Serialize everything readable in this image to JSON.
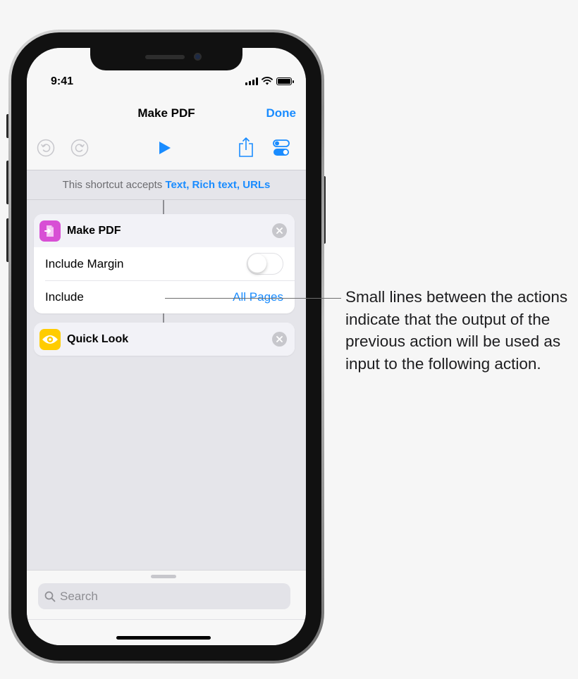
{
  "status_bar": {
    "time": "9:41"
  },
  "nav": {
    "title": "Make PDF",
    "done_label": "Done"
  },
  "toolbar": {
    "undo_icon": "undo-icon",
    "redo_icon": "redo-icon",
    "play_icon": "play-icon",
    "share_icon": "share-icon",
    "settings_icon": "settings-toggle-icon"
  },
  "accepts": {
    "prefix": "This shortcut accepts",
    "types": "Text, Rich text, URLs"
  },
  "actions": [
    {
      "title": "Make PDF",
      "icon": "document-icon",
      "icon_color": "#d84fd5",
      "rows": [
        {
          "label": "Include Margin",
          "toggle_on": false
        },
        {
          "label": "Include",
          "value": "All Pages"
        }
      ]
    },
    {
      "title": "Quick Look",
      "icon": "eye-icon",
      "icon_color": "#ffcc00"
    }
  ],
  "search": {
    "placeholder": "Search"
  },
  "callout": {
    "text": "Small lines between the actions indicate that the output of the previous action will be used as input to the following action."
  },
  "colors": {
    "accent": "#1a8cff",
    "background": "#e5e5ea"
  }
}
